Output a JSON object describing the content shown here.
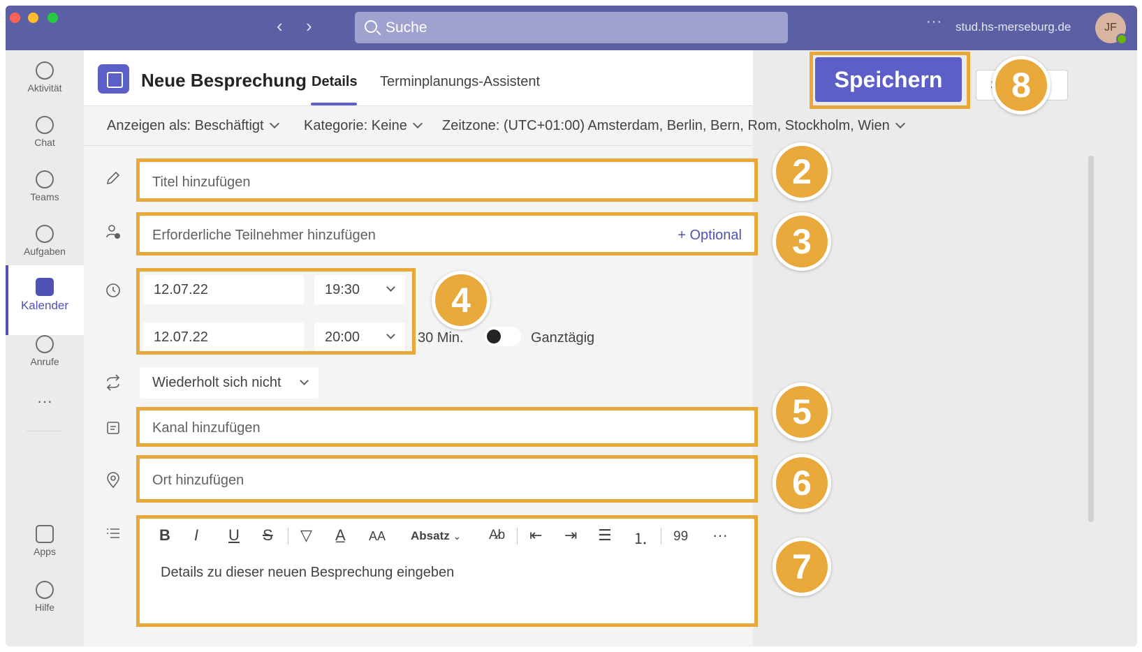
{
  "titlebar": {
    "search_placeholder": "Suche",
    "more": "···",
    "domain": "stud.hs-merseburg.de",
    "avatar_initials": "JF"
  },
  "rail": {
    "items": [
      {
        "label": "Aktivität",
        "icon": "bell-icon"
      },
      {
        "label": "Chat",
        "icon": "chat-icon"
      },
      {
        "label": "Teams",
        "icon": "teams-icon"
      },
      {
        "label": "Aufgaben",
        "icon": "backpack-icon"
      },
      {
        "label": "Kalender",
        "icon": "calendar-icon"
      },
      {
        "label": "Anrufe",
        "icon": "phone-icon"
      }
    ],
    "more": "···",
    "bottom": [
      {
        "label": "Apps",
        "icon": "apps-icon"
      },
      {
        "label": "Hilfe",
        "icon": "help-icon"
      }
    ]
  },
  "header": {
    "title": "Neue Besprechung",
    "tabs": [
      "Details",
      "Terminplanungs-Assistent"
    ],
    "save_label": "Speichern",
    "send_label": "Senden"
  },
  "options": {
    "show_as": "Anzeigen als: Beschäftigt",
    "category": "Kategorie: Keine",
    "timezone": "Zeitzone: (UTC+01:00) Amsterdam, Berlin, Bern, Rom, Stockholm, Wien",
    "more": "···"
  },
  "form": {
    "title_placeholder": "Titel hinzufügen",
    "attendees_placeholder": "Erforderliche Teilnehmer hinzufügen",
    "optional_label": "+ Optional",
    "start_date": "12.07.22",
    "start_time": "19:30",
    "end_date": "12.07.22",
    "end_time": "20:00",
    "duration": "30 Min.",
    "all_day_label": "Ganztägig",
    "repeat": "Wiederholt sich nicht",
    "channel_placeholder": "Kanal hinzufügen",
    "location_placeholder": "Ort hinzufügen",
    "details_placeholder": "Details zu dieser neuen Besprechung eingeben"
  },
  "editor_toolbar": {
    "bold": "B",
    "italic": "I",
    "underline": "U",
    "strike": "S",
    "paragraph": "Absatz",
    "quote": "99",
    "more": "···"
  },
  "callouts": [
    "2",
    "3",
    "4",
    "5",
    "6",
    "7",
    "8"
  ],
  "colors": {
    "accent": "#5b5fc7",
    "titlebar": "#5b5fa3",
    "highlight": "#e8a93a"
  }
}
